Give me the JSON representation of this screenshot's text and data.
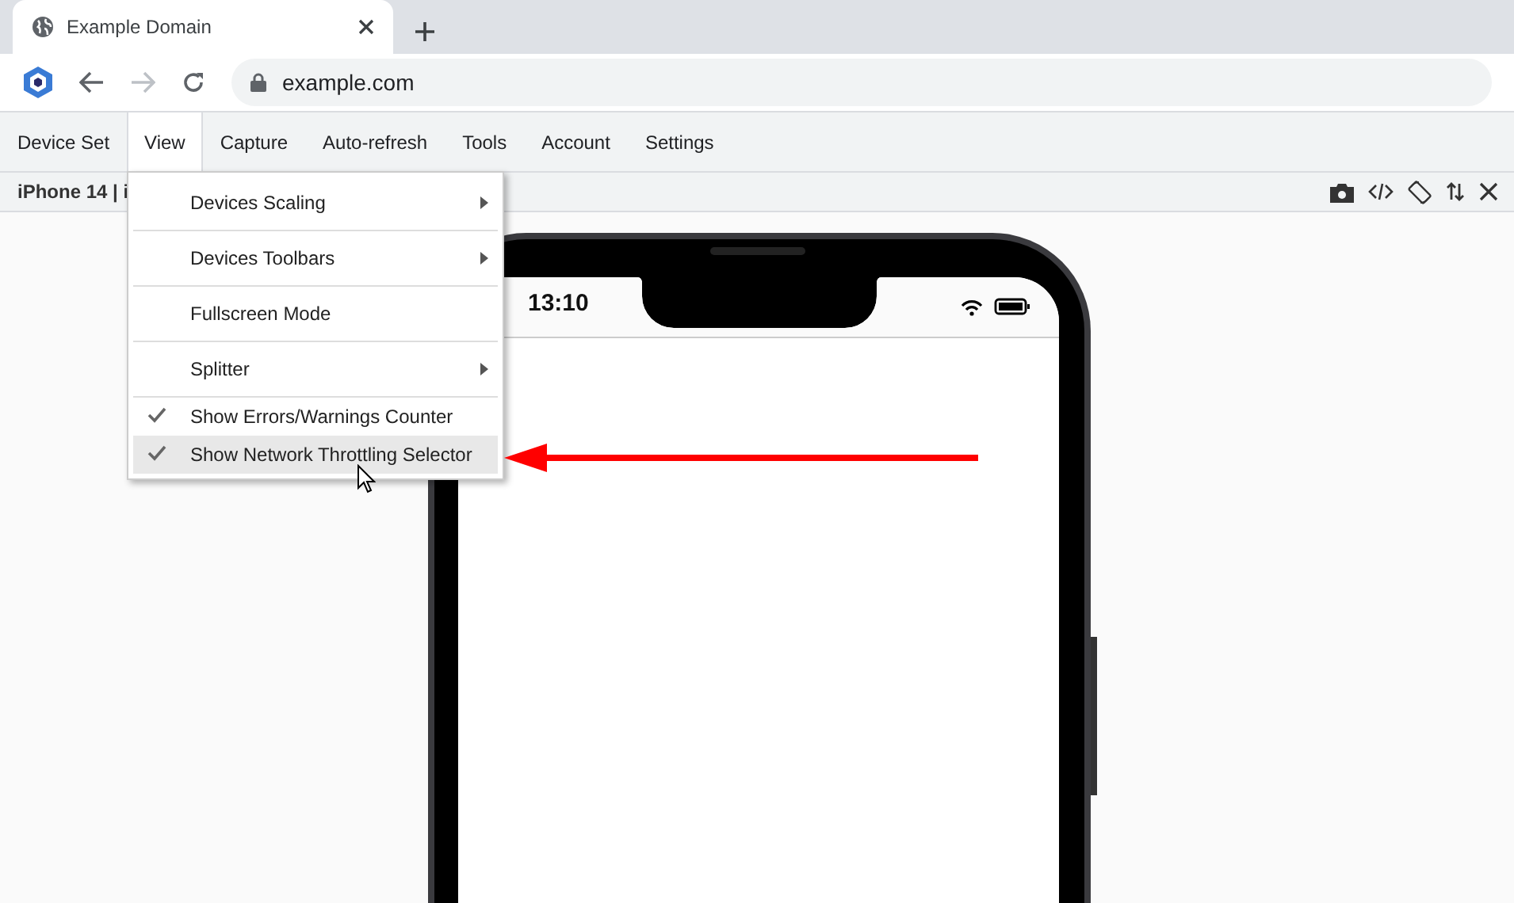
{
  "browser": {
    "tab": {
      "title": "Example Domain"
    },
    "address": "example.com"
  },
  "menubar": [
    {
      "label": "Device Set",
      "selected": false
    },
    {
      "label": "View",
      "selected": true
    },
    {
      "label": "Capture",
      "selected": false
    },
    {
      "label": "Auto-refresh",
      "selected": false
    },
    {
      "label": "Tools",
      "selected": false
    },
    {
      "label": "Account",
      "selected": false
    },
    {
      "label": "Settings",
      "selected": false
    }
  ],
  "device_toolbar": {
    "device": "iPhone 14 | i"
  },
  "view_menu": [
    {
      "label": "Devices Scaling",
      "kind": "submenu",
      "selected": false
    },
    {
      "label": "Devices Toolbars",
      "kind": "submenu",
      "selected": false
    },
    {
      "label": "Fullscreen Mode",
      "kind": "plain",
      "selected": false
    },
    {
      "label": "Splitter",
      "kind": "submenu",
      "selected": false
    },
    {
      "label": "Show Errors/Warnings Counter",
      "kind": "check",
      "checked": true,
      "selected": false
    },
    {
      "label": "Show Network Throttling Selector",
      "kind": "check",
      "checked": true,
      "selected": true
    }
  ],
  "phone": {
    "time": "13:10"
  }
}
